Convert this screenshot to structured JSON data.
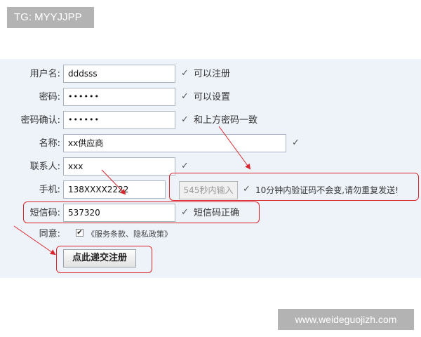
{
  "watermarks": {
    "top_left": "TG: MYYJJPP",
    "bottom_right": "www.weideguojizh.com"
  },
  "form": {
    "username": {
      "label": "用户名:",
      "value": "dddsss",
      "hint": "可以注册"
    },
    "password": {
      "label": "密码:",
      "value": "••••••",
      "hint": "可以设置"
    },
    "confirm_password": {
      "label": "密码确认:",
      "value": "••••••",
      "hint": "和上方密码一致"
    },
    "name": {
      "label": "名称:",
      "value": "xx供应商"
    },
    "contact": {
      "label": "联系人:",
      "value": "xxx"
    },
    "phone": {
      "label": "手机:",
      "value": "138XXXX2222",
      "sms_button": "545秒内输入",
      "hint": "10分钟内验证码不会变,请勿重复发送!"
    },
    "sms_code": {
      "label": "短信码:",
      "value": "537320",
      "hint": "短信码正确"
    },
    "agree": {
      "label": "同意:",
      "text": "《服务条款、隐私政策》",
      "checked": true
    },
    "submit_label": "点此递交注册"
  },
  "icons": {
    "check": "check-icon",
    "checkbox": "checkbox-icon"
  },
  "colors": {
    "annotation_red": "#d9262c",
    "form_background": "#eef3fa"
  }
}
